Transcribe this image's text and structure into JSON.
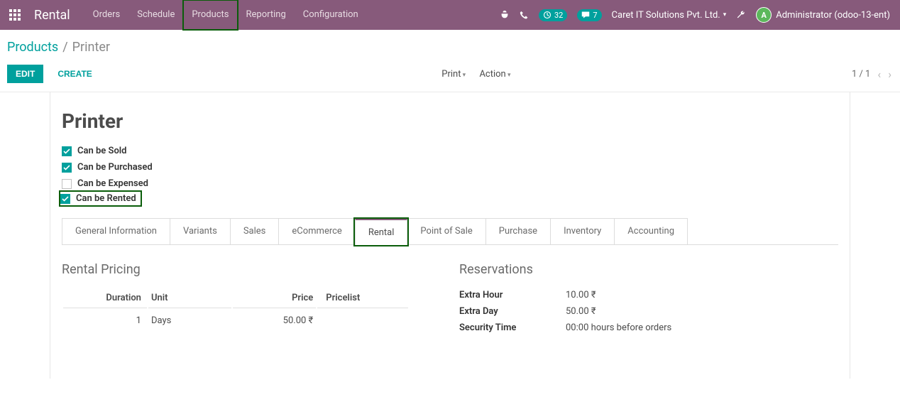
{
  "topbar": {
    "brand": "Rental",
    "nav": [
      "Orders",
      "Schedule",
      "Products",
      "Reporting",
      "Configuration"
    ],
    "badge_clock": "32",
    "badge_msg": "7",
    "company": "Caret IT Solutions Pvt. Ltd.",
    "user": "Administrator (odoo-13-ent)",
    "avatar_letter": "A"
  },
  "breadcrumb": {
    "root": "Products",
    "current": "Printer"
  },
  "controls": {
    "edit": "EDIT",
    "create": "CREATE",
    "print": "Print",
    "action": "Action",
    "pager": "1 / 1"
  },
  "product": {
    "name": "Printer",
    "checks": [
      {
        "label": "Can be Sold",
        "checked": true
      },
      {
        "label": "Can be Purchased",
        "checked": true
      },
      {
        "label": "Can be Expensed",
        "checked": false
      },
      {
        "label": "Can be Rented",
        "checked": true
      }
    ]
  },
  "tabs": [
    "General Information",
    "Variants",
    "Sales",
    "eCommerce",
    "Rental",
    "Point of Sale",
    "Purchase",
    "Inventory",
    "Accounting"
  ],
  "active_tab": "Rental",
  "rental_pricing": {
    "title": "Rental Pricing",
    "headers": {
      "duration": "Duration",
      "unit": "Unit",
      "price": "Price",
      "pricelist": "Pricelist"
    },
    "rows": [
      {
        "duration": "1",
        "unit": "Days",
        "price": "50.00 ₹",
        "pricelist": ""
      }
    ]
  },
  "reservations": {
    "title": "Reservations",
    "rows": [
      {
        "label": "Extra Hour",
        "value": "10.00 ₹"
      },
      {
        "label": "Extra Day",
        "value": "50.00 ₹"
      },
      {
        "label": "Security Time",
        "value": "00:00 hours before orders"
      }
    ]
  }
}
